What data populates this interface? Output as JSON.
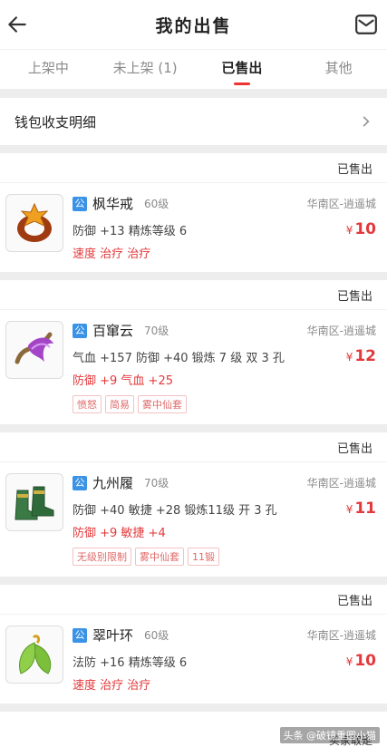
{
  "header": {
    "title": "我的出售"
  },
  "tabs": [
    {
      "label": "上架中"
    },
    {
      "label": "未上架 (1)"
    },
    {
      "label": "已售出"
    },
    {
      "label": "其他"
    }
  ],
  "active_tab": 2,
  "wallet": {
    "label": "钱包收支明细"
  },
  "items": [
    {
      "status": "已售出",
      "badge": "公",
      "name": "枫华戒",
      "level": "60级",
      "server": "华南区-逍遥城",
      "stats": "防御 +13 精炼等级 6",
      "extra": "速度 治疗 治疗",
      "price": "10",
      "currency": "¥",
      "tags": []
    },
    {
      "status": "已售出",
      "badge": "公",
      "name": "百窜云",
      "level": "70级",
      "server": "华南区-逍遥城",
      "stats": "气血 +157 防御 +40 锻炼 7 级 双 3 孔",
      "extra": "防御 +9 气血 +25",
      "price": "12",
      "currency": "¥",
      "tags": [
        "愤怒",
        "简易",
        "雾中仙套"
      ]
    },
    {
      "status": "已售出",
      "badge": "公",
      "name": "九州履",
      "level": "70级",
      "server": "华南区-逍遥城",
      "stats": "防御 +40 敏捷 +28 锻炼11级 开 3 孔",
      "extra": "防御 +9 敏捷 +4",
      "price": "11",
      "currency": "¥",
      "tags": [
        "无级别限制",
        "雾中仙套",
        "11锻"
      ]
    },
    {
      "status": "已售出",
      "badge": "公",
      "name": "翠叶环",
      "level": "60级",
      "server": "华南区-逍遥城",
      "stats": "法防 +16 精炼等级 6",
      "extra": "速度 治疗 治疗",
      "price": "10",
      "currency": "¥",
      "tags": []
    }
  ],
  "bottom_status": "买家取走",
  "watermark": "头条 @破镜重圆小猫",
  "colors": {
    "accent": "#e3393c",
    "badge": "#3a93e6"
  }
}
